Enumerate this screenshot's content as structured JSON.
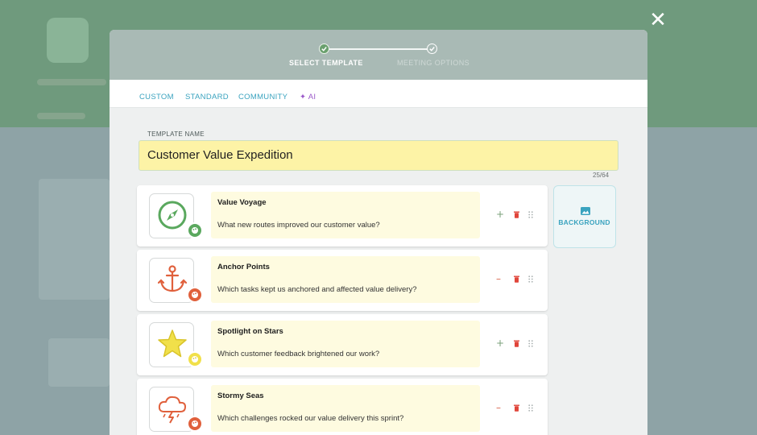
{
  "stepper": {
    "steps": [
      {
        "label": "SELECT TEMPLATE",
        "state": "active"
      },
      {
        "label": "MEETING OPTIONS",
        "state": "inactive"
      }
    ]
  },
  "tabs": [
    {
      "label": "CUSTOM"
    },
    {
      "label": "STANDARD"
    },
    {
      "label": "COMMUNITY"
    },
    {
      "label": "AI"
    }
  ],
  "template": {
    "field_label": "TEMPLATE NAME",
    "name": "Customer Value Expedition",
    "counter": "25/64"
  },
  "questions": [
    {
      "title": "Value Voyage",
      "text": "What new routes improved our customer value?",
      "icon": "compass-icon",
      "color": "#5aa85e",
      "action": "plus"
    },
    {
      "title": "Anchor Points",
      "text": "Which tasks kept us anchored and affected value delivery?",
      "icon": "anchor-icon",
      "color": "#e0603c",
      "action": "minus"
    },
    {
      "title": "Spotlight on Stars",
      "text": "Which customer feedback brightened our work?",
      "icon": "star-icon",
      "color": "#f1e04a",
      "action": "plus"
    },
    {
      "title": "Stormy Seas",
      "text": "Which challenges rocked our value delivery this sprint?",
      "icon": "storm-cloud-icon",
      "color": "#e0603c",
      "action": "minus"
    }
  ],
  "background_button": {
    "label": "BACKGROUND",
    "icon": "image-icon"
  },
  "colors": {
    "accent": "#3aa3bf",
    "ai": "#9b59c9",
    "input_bg": "#fdf3a6"
  }
}
